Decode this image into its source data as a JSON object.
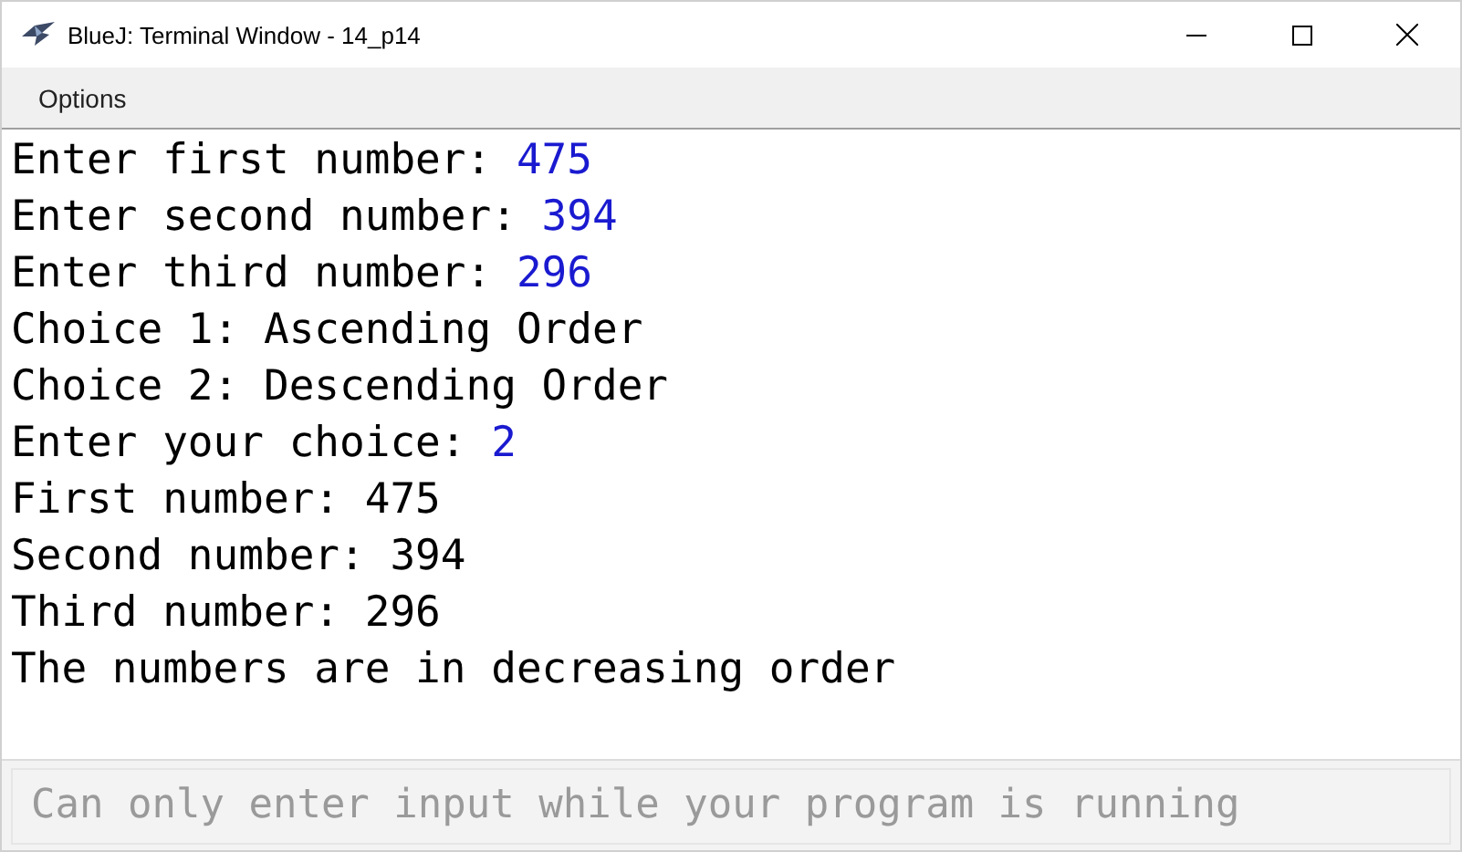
{
  "window": {
    "title": "BlueJ: Terminal Window - 14_p14"
  },
  "menu": [
    "Options"
  ],
  "terminal": [
    [
      {
        "kind": "output",
        "text": "Enter first number: "
      },
      {
        "kind": "input",
        "text": "475"
      }
    ],
    [
      {
        "kind": "output",
        "text": "Enter second number: "
      },
      {
        "kind": "input",
        "text": "394"
      }
    ],
    [
      {
        "kind": "output",
        "text": "Enter third number: "
      },
      {
        "kind": "input",
        "text": "296"
      }
    ],
    [
      {
        "kind": "output",
        "text": "Choice 1: Ascending Order"
      }
    ],
    [
      {
        "kind": "output",
        "text": "Choice 2: Descending Order"
      }
    ],
    [
      {
        "kind": "output",
        "text": "Enter your choice: "
      },
      {
        "kind": "input",
        "text": "2"
      }
    ],
    [
      {
        "kind": "output",
        "text": "First number: 475"
      }
    ],
    [
      {
        "kind": "output",
        "text": "Second number: 394"
      }
    ],
    [
      {
        "kind": "output",
        "text": "Third number: 296"
      }
    ],
    [
      {
        "kind": "output",
        "text": "The numbers are in decreasing order"
      }
    ]
  ],
  "input_field": {
    "placeholder": "Can only enter input while your program is running",
    "disabled": true
  }
}
